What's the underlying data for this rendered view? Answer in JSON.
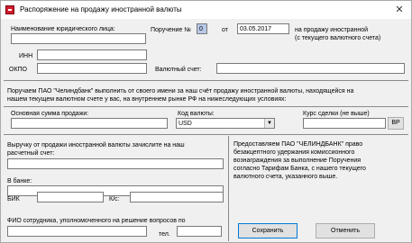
{
  "window": {
    "title": "Распоряжение на продажу иностранной валюты",
    "close_glyph": "✕"
  },
  "form": {
    "org_name_label": "Наименование юридического лица:",
    "org_name_value": "",
    "inn_label": "ИНН",
    "inn_value": "",
    "okpo_label": "ОКПО",
    "okpo_value": "",
    "order_label": "Поручение №",
    "order_number": "0",
    "from_label": "от",
    "order_date": "03.05.2017",
    "currency_account_label": "Валютный счет:",
    "currency_account_value": "",
    "on_sale_note_line1": "на продажу иностранной",
    "on_sale_note_line2": "(с текущего валютного счета)",
    "instruction_line1": "Поручаем ПАО \"Челиндбанк\" выполнить от своего имени за наш счёт продажу иностранной валюты, находящейся на",
    "instruction_line2": "нашем текущем валютном счете у вас, на внутреннем рынке РФ на нижеследующих условиях:",
    "main_amount_label": "Основная сумма продажи:",
    "main_amount_value": "",
    "currency_code_label": "Код валюты:",
    "currency_code_value": "USD",
    "rate_label": "Курс сделки (не выше)",
    "rate_value": "",
    "rate_button": "ВР",
    "proceeds_label_line1": "Выручку от продажи иностранной валюты зачислите на наш",
    "proceeds_label_line2": "расчетный счет:",
    "proceeds_account_value": "",
    "bank_label": "В банке:",
    "bank_value": "",
    "bik_label": "БИК",
    "bik_value": "",
    "ks_label": "К/с:",
    "ks_value": "",
    "employee_label": "ФИО сотрудника, уполномоченного на решение вопросов по",
    "employee_value": "",
    "phone_label": "тел.",
    "phone_value": "",
    "commission_note": "Предоставляем ПАО \"ЧЕЛИНДБАНК\" право безакцептного удержания комиссионного вознаграждения за выполнение Поручения согласно Тарифам Банка, с нашего текущего валютного счета, указанного выше."
  },
  "buttons": {
    "save": "Сохранить",
    "cancel": "Отменить"
  },
  "combo_arrow": "▼"
}
